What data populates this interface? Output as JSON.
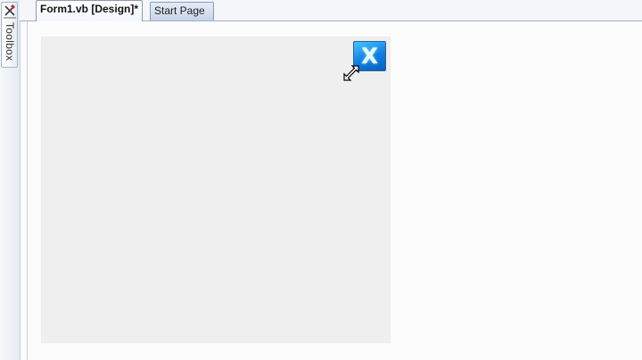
{
  "toolbox": {
    "label": "Toolbox",
    "icon": "toolbox-icon"
  },
  "tabs": [
    {
      "label": "Form1.vb [Design]*",
      "active": true
    },
    {
      "label": "Start Page",
      "active": false
    }
  ],
  "designer": {
    "control": {
      "icon": "x-icon",
      "glyph": "X"
    },
    "cursor": "resize-diagonal-cursor"
  },
  "colors": {
    "form_background": "#efefef",
    "control_blue": "#0f7ee0",
    "tab_active_bg": "#ffffff",
    "tab_inactive_bg": "#c7d4e6"
  }
}
